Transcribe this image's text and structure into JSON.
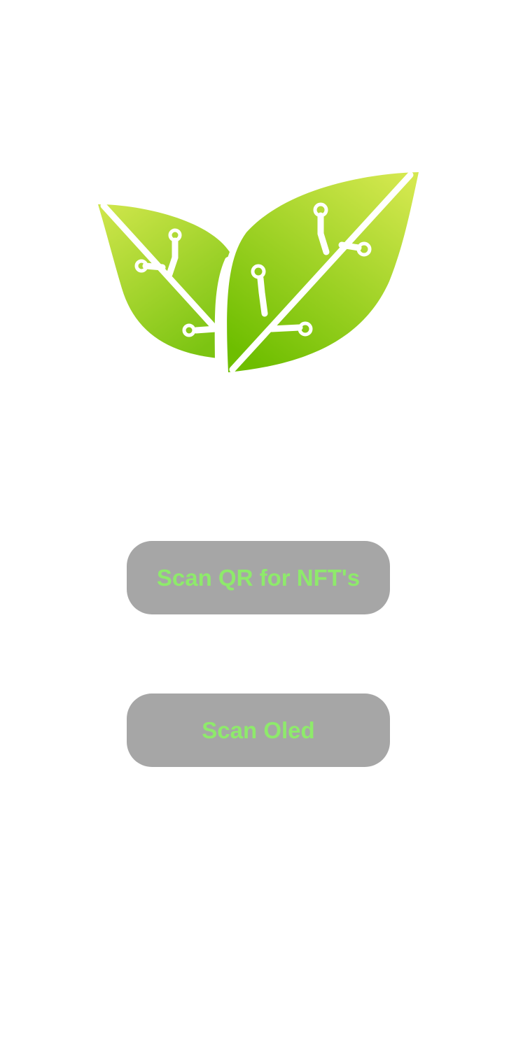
{
  "logo": {
    "icon": "leaf-circuit-icon",
    "gradient_light": "#D4E84F",
    "gradient_dark": "#6EBE00"
  },
  "buttons": {
    "scan_nft_label": "Scan QR for NFT's",
    "scan_oled_label": "Scan Oled"
  },
  "colors": {
    "background": "#FFFFFF",
    "button_background": "#A6A6A6",
    "button_text": "#8EEA6B"
  }
}
